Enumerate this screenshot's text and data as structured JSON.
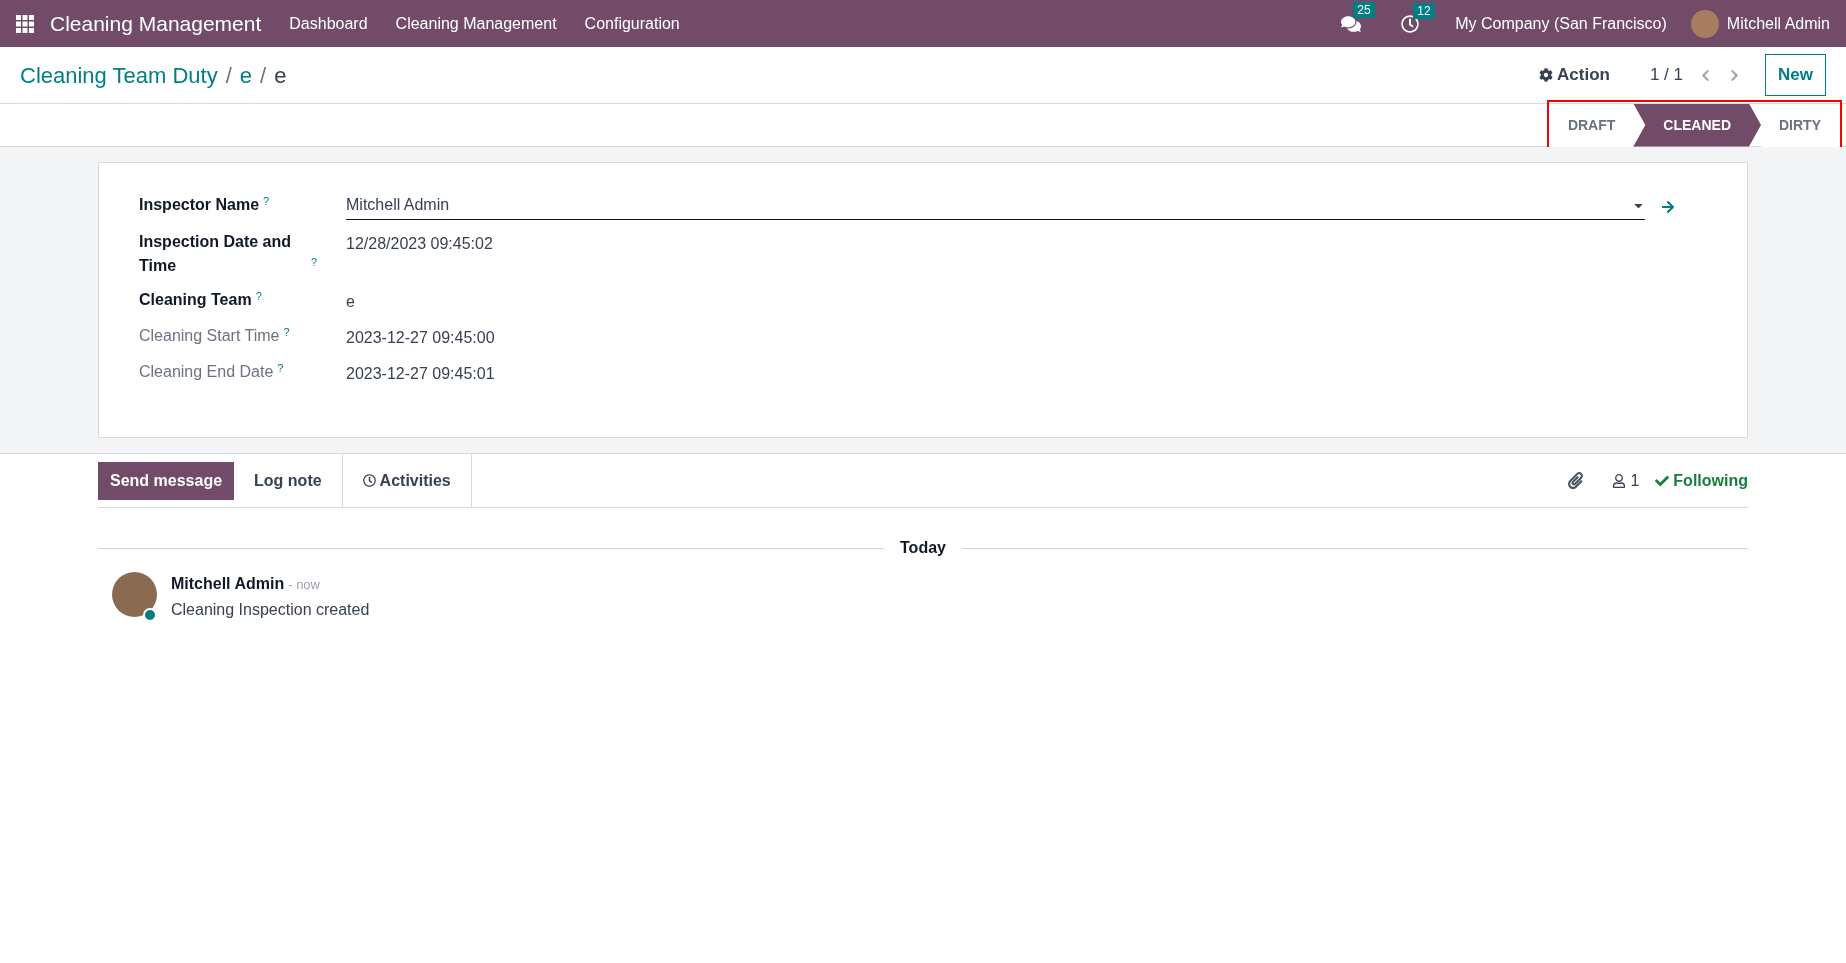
{
  "navbar": {
    "app_title": "Cleaning Management",
    "menu": [
      "Dashboard",
      "Cleaning Management",
      "Configuration"
    ],
    "messages_count": "25",
    "activities_count": "12",
    "company": "My Company (San Francisco)",
    "user": "Mitchell Admin"
  },
  "breadcrumb": {
    "items": [
      "Cleaning Team Duty",
      "e"
    ],
    "separators": [
      "/",
      "/"
    ],
    "current": "e"
  },
  "control_panel": {
    "action": "Action",
    "pager": "1 / 1",
    "new_button": "New"
  },
  "statusbar": [
    {
      "label": "DRAFT",
      "selected": false
    },
    {
      "label": "CLEANED",
      "selected": true
    },
    {
      "label": "DIRTY",
      "selected": false
    }
  ],
  "form_fields": [
    {
      "label": "Inspector Name",
      "help": "?",
      "value": "Mitchell Admin",
      "kind": "select",
      "readonly": false
    },
    {
      "label": "Inspection Date and Time",
      "help": "?",
      "value": "12/28/2023 09:45:02",
      "kind": "text",
      "readonly": false
    },
    {
      "label": "Cleaning Team",
      "help": "?",
      "value": "e",
      "kind": "text",
      "readonly": false
    },
    {
      "label": "Cleaning Start Time",
      "help": "?",
      "value": "2023-12-27 09:45:00",
      "kind": "text",
      "readonly": true
    },
    {
      "label": "Cleaning End Date",
      "help": "?",
      "value": "2023-12-27 09:45:01",
      "kind": "text",
      "readonly": true
    }
  ],
  "chatter": {
    "tabs": [
      {
        "label": "Send message",
        "selected": true
      },
      {
        "label": "Log note",
        "selected": false
      },
      {
        "label": "Activities",
        "selected": false
      }
    ],
    "followers_count": "1",
    "following": "Following",
    "date_separator": "Today",
    "messages": [
      {
        "author": "Mitchell Admin",
        "time": "- now",
        "body": "Cleaning Inspection created"
      }
    ]
  }
}
